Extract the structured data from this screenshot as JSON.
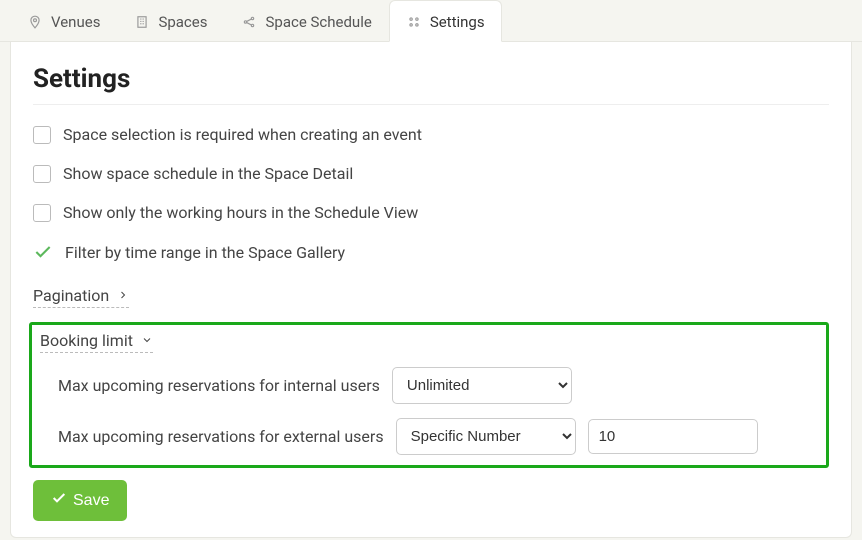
{
  "tabs": {
    "venues": "Venues",
    "spaces": "Spaces",
    "schedule": "Space Schedule",
    "settings": "Settings"
  },
  "page_title": "Settings",
  "options": {
    "space_selection_required": "Space selection is required when creating an event",
    "show_space_schedule": "Show space schedule in the Space Detail",
    "show_working_hours": "Show only the working hours in the Schedule View",
    "filter_by_time_range": "Filter by time range in the Space Gallery"
  },
  "sections": {
    "pagination": "Pagination",
    "booking_limit": "Booking limit"
  },
  "booking": {
    "internal_label": "Max upcoming reservations for internal users",
    "external_label": "Max upcoming reservations for external users",
    "internal_select": "Unlimited",
    "external_select": "Specific Number",
    "external_value": "10",
    "select_options": {
      "unlimited": "Unlimited",
      "specific": "Specific Number"
    }
  },
  "save_label": "Save"
}
